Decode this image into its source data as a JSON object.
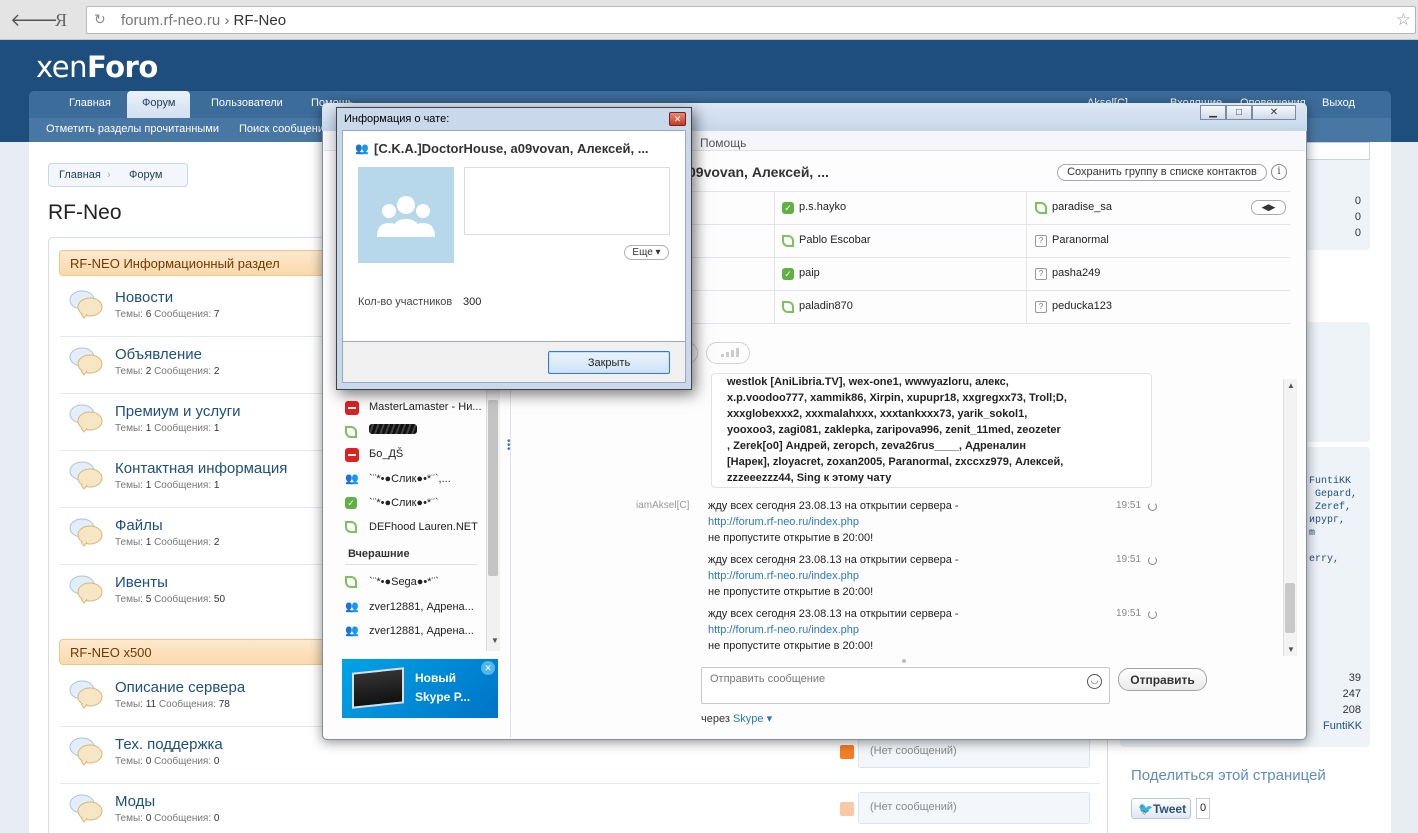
{
  "browser": {
    "url_domain": "forum.rf-neo.ru",
    "url_sep": "›",
    "page_title": "RF-Neo"
  },
  "forum": {
    "logo_light": "xen",
    "logo_bold": "Foro",
    "nav_tabs": [
      "Главная",
      "Форум",
      "Пользователи",
      "Помощь"
    ],
    "nav_user": "Aksel[C]",
    "nav_right": [
      "Входящие",
      "Оповещения",
      "Выход"
    ],
    "subnav": [
      "Отметить разделы прочитанными",
      "Поиск сообщений"
    ],
    "breadcrumb": [
      "Главная",
      "Форум"
    ],
    "page_title": "RF-Neo",
    "stats_labels": {
      "topics": "Темы:",
      "messages": "Сообщения:"
    },
    "categories": [
      {
        "title": "RF-NEO Информационный раздел",
        "nodes": [
          {
            "title": "Новости",
            "topics": "6",
            "messages": "7"
          },
          {
            "title": "Объявление",
            "topics": "2",
            "messages": "2"
          },
          {
            "title": "Премиум и услуги",
            "topics": "1",
            "messages": "1"
          },
          {
            "title": "Контактная информация",
            "topics": "1",
            "messages": "1"
          },
          {
            "title": "Файлы",
            "topics": "1",
            "messages": "2"
          },
          {
            "title": "Ивенты",
            "topics": "5",
            "messages": "50"
          }
        ]
      },
      {
        "title": "RF-NEO x500",
        "nodes": [
          {
            "title": "Описание сервера",
            "topics": "11",
            "messages": "78"
          },
          {
            "title": "Тех. поддержка",
            "topics": "0",
            "messages": "0",
            "last": "(Нет сообщений)"
          },
          {
            "title": "Моды",
            "topics": "0",
            "messages": "0",
            "last": "(Нет сообщений)"
          }
        ]
      }
    ],
    "sidebar": {
      "stats_top": [
        "0",
        "0",
        "0"
      ],
      "users": [
        "FuntiKK",
        ", Gepard,",
        ", Zeref,",
        "ирург,",
        "m",
        "erry,"
      ],
      "stats_bottom": [
        "39",
        "247",
        "208"
      ],
      "latest_member": "FuntiKK",
      "share_title": "Поделиться этой страницей",
      "tweet_label": "Tweet",
      "tweet_count": "0"
    }
  },
  "skype": {
    "menu_fragment": "Помощь",
    "group_title_fragment": "09vovan, Алексей, ...",
    "save_group_label": "Сохранить группу в списке контактов",
    "info_icon": "i",
    "members": [
      {
        "name": "p.s.hayko",
        "status": "online"
      },
      {
        "name": "paradise_sa",
        "status": "offline"
      },
      {
        "name": "Pablo Escobar",
        "status": "offline"
      },
      {
        "name": "Paranormal",
        "status": "unknown"
      },
      {
        "name": "paip",
        "status": "online"
      },
      {
        "name": "pasha249",
        "status": "unknown"
      },
      {
        "name": "paladin870",
        "status": "offline"
      },
      {
        "name": "peducka123",
        "status": "unknown"
      }
    ],
    "contacts": [
      {
        "name": "MasterLamaster - Ни...",
        "icon": "blocked"
      },
      {
        "name": "",
        "icon": "scribble"
      },
      {
        "name": "Бо_ДŠ",
        "icon": "blocked"
      },
      {
        "name": "`¨*•●Слик●•*¨`,...",
        "icon": "group"
      },
      {
        "name": "`¨*•●Слик●•*¨`",
        "icon": "online"
      },
      {
        "name": "DEFhood Lauren.NET",
        "icon": "offline"
      }
    ],
    "yesterday_label": "Вчерашние",
    "yesterday_contacts": [
      {
        "name": "`¨*•●Sega●•*¨`",
        "icon": "offline"
      },
      {
        "name": "zver12881, Адрена...",
        "icon": "group"
      },
      {
        "name": "zver12881, Адрена...",
        "icon": "group"
      }
    ],
    "ad": {
      "line1": "Новый",
      "line2": "Skype P..."
    },
    "bubble_lines": [
      "westlok [AniLibria.TV], wex-one1, wwwyazloru, алекс,",
      "x.p.voodoo777, xammik86, Xirpin, xupupr18, xxgregxx73, Troll;D,",
      "xxxglobexxx2, xxxmalahxxx, xxxtankxxx73, yarik_sokol1,",
      "yooxoo3, zagi081, zaklepka, zaripova996, zenit_11med, zeozeter",
      ", Zerek[o0] Андрей, zeropch, zeva26rus____, Адреналин",
      "[Нарек], zloyacret, zoxan2005, Paranormal, zxccxz979, Алексей,",
      "zzzeeezzz44, Sing к этому чату"
    ],
    "messages": [
      {
        "author": "iamAksel[C]",
        "line1": "жду всех сегодня 23.08.13 на открытии сервера -",
        "link": "http://forum.rf-neo.ru/index.php",
        "line3": "не пропустите открытие в 20:00!",
        "time": "19:51"
      },
      {
        "author": "",
        "line1": "жду всех сегодня 23.08.13 на открытии сервера -",
        "link": "http://forum.rf-neo.ru/index.php",
        "line3": "не пропустите открытие в 20:00!",
        "time": "19:51"
      },
      {
        "author": "",
        "line1": "жду всех сегодня 23.08.13 на открытии сервера -",
        "link": "http://forum.rf-neo.ru/index.php",
        "line3": "не пропустите открытие в 20:00!",
        "time": "19:51"
      }
    ],
    "input_placeholder": "Отправить сообщение",
    "send_label": "Отправить",
    "via_label": "через",
    "via_service": "Skype ▾"
  },
  "dialog": {
    "title": "Информация о чате:",
    "group_name": "[C.K.A.]DoctorHouse, a09vovan, Алексей, ...",
    "more_label": "Еще ▾",
    "participants_label": "Кол-во участников",
    "participants_count": "300",
    "close_label": "Закрыть"
  }
}
